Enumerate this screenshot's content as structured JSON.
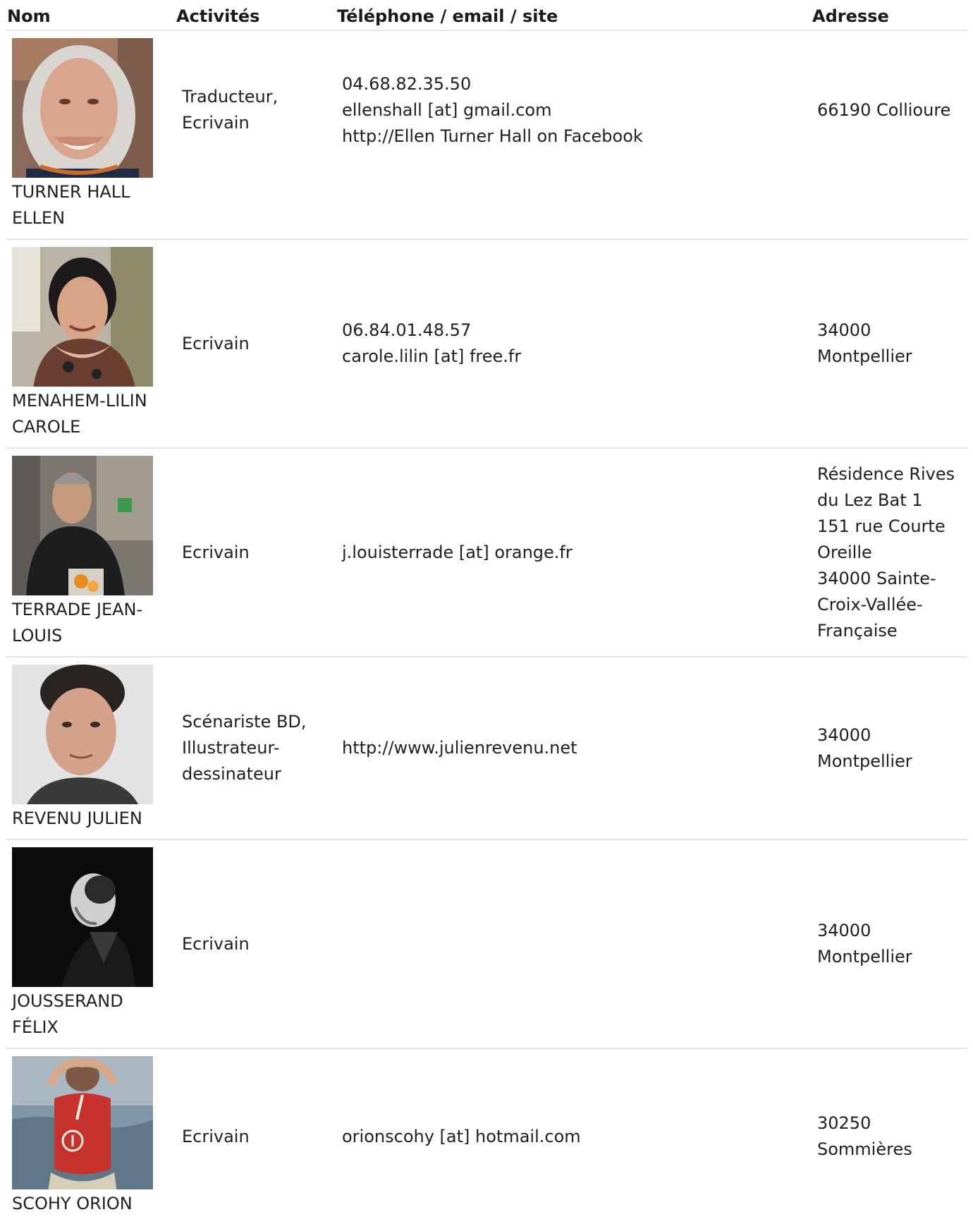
{
  "headers": {
    "nom": "Nom",
    "activites": "Activités",
    "contact": "Téléphone / email / site",
    "adresse": "Adresse"
  },
  "rows": [
    {
      "name_line1": "TURNER HALL",
      "name_line2": "ELLEN",
      "activity_line1": "Traducteur,",
      "activity_line2": "Ecrivain",
      "activity_line3": "",
      "contact_line1": "04.68.82.35.50",
      "contact_line2": "ellenshall [at] gmail.com",
      "contact_line3": "http://Ellen Turner Hall on Facebook",
      "address_lines": [
        "66190 Collioure"
      ]
    },
    {
      "name_line1": "MENAHEM-LILIN",
      "name_line2": "CAROLE",
      "activity_line1": "Ecrivain",
      "activity_line2": "",
      "activity_line3": "",
      "contact_line1": "06.84.01.48.57",
      "contact_line2": "carole.lilin [at] free.fr",
      "contact_line3": "",
      "address_lines": [
        "34000",
        "Montpellier"
      ]
    },
    {
      "name_line1": "TERRADE JEAN-",
      "name_line2": "LOUIS",
      "activity_line1": "Ecrivain",
      "activity_line2": "",
      "activity_line3": "",
      "contact_line1": "j.louisterrade [at] orange.fr",
      "contact_line2": "",
      "contact_line3": "",
      "address_lines": [
        "Résidence Rives",
        "du Lez Bat 1",
        "151 rue Courte",
        "Oreille",
        "34000 Sainte-",
        "Croix-Vallée-",
        "Française"
      ]
    },
    {
      "name_line1": "REVENU JULIEN",
      "name_line2": "",
      "activity_line1": "Scénariste BD,",
      "activity_line2": "Illustrateur-",
      "activity_line3": "dessinateur",
      "contact_line1": "http://www.julienrevenu.net",
      "contact_line2": "",
      "contact_line3": "",
      "address_lines": [
        "34000",
        "Montpellier"
      ]
    },
    {
      "name_line1": "JOUSSERAND",
      "name_line2": "FÉLIX",
      "activity_line1": "Ecrivain",
      "activity_line2": "",
      "activity_line3": "",
      "contact_line1": "",
      "contact_line2": "",
      "contact_line3": "",
      "address_lines": [
        "34000",
        "Montpellier"
      ]
    },
    {
      "name_line1": "SCOHY ORION",
      "name_line2": "",
      "activity_line1": "Ecrivain",
      "activity_line2": "",
      "activity_line3": "",
      "contact_line1": "orionscohy [at] hotmail.com",
      "contact_line2": "",
      "contact_line3": "",
      "address_lines": [
        "30250",
        "Sommières"
      ]
    }
  ],
  "addr": {
    "r0": {
      "l0": "66190 Collioure"
    },
    "r1": {
      "l0": "34000",
      "l1": "Montpellier"
    },
    "r2": {
      "l0": "Résidence Rives",
      "l1": "du Lez Bat 1",
      "l2": "151 rue Courte",
      "l3": "Oreille",
      "l4": "34000 Sainte-",
      "l5": "Croix-Vallée-",
      "l6": "Française"
    },
    "r3": {
      "l0": "34000",
      "l1": "Montpellier"
    },
    "r4": {
      "l0": "34000",
      "l1": "Montpellier"
    },
    "r5": {
      "l0": "30250",
      "l1": "Sommières"
    }
  }
}
